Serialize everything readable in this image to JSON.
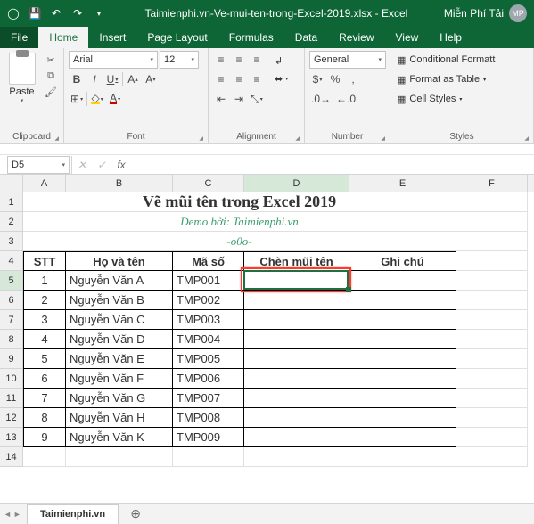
{
  "title_bar": {
    "filename": "Taimienphi.vn-Ve-mui-ten-trong-Excel-2019.xlsx - Excel",
    "user_label": "Miễn Phí Tải",
    "avatar": "MP"
  },
  "tabs": {
    "file": "File",
    "home": "Home",
    "insert": "Insert",
    "page_layout": "Page Layout",
    "formulas": "Formulas",
    "data": "Data",
    "review": "Review",
    "view": "View",
    "help": "Help"
  },
  "ribbon": {
    "clipboard": {
      "label": "Clipboard",
      "paste": "Paste"
    },
    "font": {
      "label": "Font",
      "name": "Arial",
      "size": "12",
      "bold": "B",
      "italic": "I",
      "underline": "U"
    },
    "alignment": {
      "label": "Alignment",
      "wrap": "Wrap Text",
      "merge": "Merge & Center"
    },
    "number": {
      "label": "Number",
      "format": "General"
    },
    "styles": {
      "label": "Styles",
      "conditional": "Conditional Formatt",
      "table": "Format as Table",
      "cell": "Cell Styles"
    }
  },
  "name_box": "D5",
  "columns": [
    "A",
    "B",
    "C",
    "D",
    "E",
    "F"
  ],
  "rows": [
    "1",
    "2",
    "3",
    "4",
    "5",
    "6",
    "7",
    "8",
    "9",
    "10",
    "11",
    "12",
    "13",
    "14"
  ],
  "sheet": {
    "title": "Vẽ mũi tên trong Excel 2019",
    "demo": "Demo bởi: Taimienphi.vn",
    "separator": "-o0o-",
    "headers": {
      "stt": "STT",
      "name": "Họ và tên",
      "code": "Mã số",
      "arrow": "Chèn mũi tên",
      "note": "Ghi chú"
    },
    "data": [
      {
        "stt": "1",
        "name": "Nguyễn Văn A",
        "code": "TMP001"
      },
      {
        "stt": "2",
        "name": "Nguyễn Văn B",
        "code": "TMP002"
      },
      {
        "stt": "3",
        "name": "Nguyễn Văn C",
        "code": "TMP003"
      },
      {
        "stt": "4",
        "name": "Nguyễn Văn D",
        "code": "TMP004"
      },
      {
        "stt": "5",
        "name": "Nguyễn Văn E",
        "code": "TMP005"
      },
      {
        "stt": "6",
        "name": "Nguyễn Văn F",
        "code": "TMP006"
      },
      {
        "stt": "7",
        "name": "Nguyễn Văn G",
        "code": "TMP007"
      },
      {
        "stt": "8",
        "name": "Nguyễn Văn H",
        "code": "TMP008"
      },
      {
        "stt": "9",
        "name": "Nguyễn Văn K",
        "code": "TMP009"
      }
    ]
  },
  "sheet_tab": "Taimienphi.vn",
  "colors": {
    "accent": "#0e6535",
    "highlight": "#ff3b30"
  }
}
